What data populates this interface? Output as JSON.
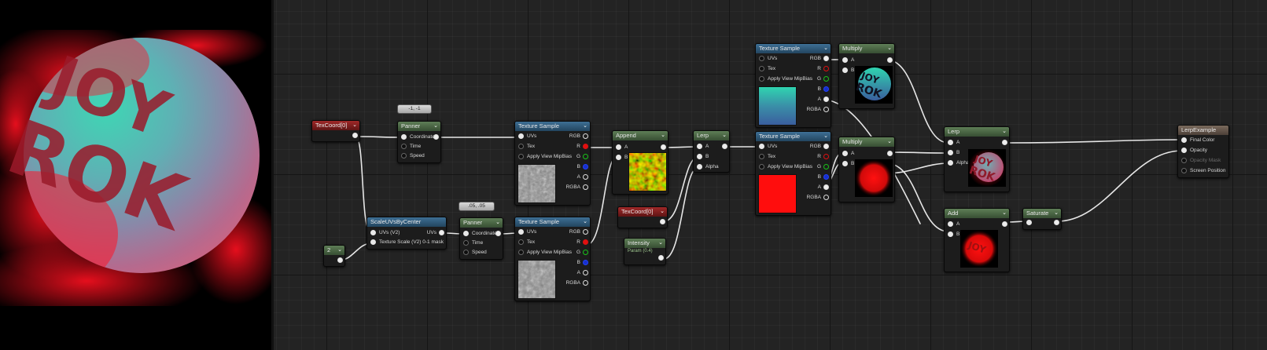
{
  "preview": {
    "logo_line1": "JOY",
    "logo_line2": "ROK"
  },
  "nodes": {
    "texcoord0": {
      "title": "TexCoord[0]"
    },
    "const2": {
      "title": "2"
    },
    "panner1": {
      "title": "Panner",
      "comment": "-1, -1",
      "pins": [
        "Coordinate",
        "Time",
        "Speed"
      ]
    },
    "scaleuvs": {
      "title": "ScaleUVsByCenter",
      "pin_uvs": "UVs (V2)",
      "pin_scale": "Texture Scale (V2) 0-1 mask",
      "out_uvs": "UVs"
    },
    "panner2": {
      "title": "Panner",
      "comment": ".05, .05",
      "pins": [
        "Coordinate",
        "Time",
        "Speed"
      ]
    },
    "texsample1": {
      "title": "Texture Sample",
      "inputs": [
        "UVs",
        "Tex",
        "Apply View MipBias"
      ],
      "outputs": [
        "RGB",
        "R",
        "G",
        "B",
        "A",
        "RGBA"
      ]
    },
    "texsample2": {
      "title": "Texture Sample",
      "inputs": [
        "UVs",
        "Tex",
        "Apply View MipBias"
      ],
      "outputs": [
        "RGB",
        "R",
        "G",
        "B",
        "A",
        "RGBA"
      ]
    },
    "append": {
      "title": "Append",
      "inputs": [
        "A",
        "B"
      ]
    },
    "texcoord0b": {
      "title": "TexCoord[0]"
    },
    "intensity": {
      "title": "Intensity",
      "subtitle": "Param (0.4)"
    },
    "lerp1": {
      "title": "Lerp",
      "inputs": [
        "A",
        "B",
        "Alpha"
      ]
    },
    "texsample3": {
      "title": "Texture Sample",
      "inputs": [
        "UVs",
        "Tex",
        "Apply View MipBias"
      ],
      "outputs": [
        "RGB",
        "R",
        "G",
        "B",
        "A",
        "RGBA"
      ]
    },
    "texsample4": {
      "title": "Texture Sample",
      "inputs": [
        "UVs",
        "Tex",
        "Apply View MipBias"
      ],
      "outputs": [
        "RGB",
        "R",
        "G",
        "B",
        "A",
        "RGBA"
      ]
    },
    "multiply1": {
      "title": "Multiply",
      "inputs": [
        "A",
        "B"
      ],
      "thumb_text1": "JOY",
      "thumb_text2": "ROK"
    },
    "multiply2": {
      "title": "Multiply",
      "inputs": [
        "A",
        "B"
      ]
    },
    "lerp2": {
      "title": "Lerp",
      "inputs": [
        "A",
        "B",
        "Alpha"
      ],
      "thumb_text1": "JOY",
      "thumb_text2": "ROK"
    },
    "add": {
      "title": "Add",
      "inputs": [
        "A",
        "B"
      ],
      "thumb_text": "JOY"
    },
    "saturate": {
      "title": "Saturate"
    },
    "result": {
      "title": "LerpExample",
      "inputs": [
        "Final Color",
        "Opacity",
        "Opacity Mask",
        "Screen Position"
      ]
    }
  },
  "colors": {
    "graph_bg": "#232323",
    "texture_header": "#3d6f95",
    "math_header": "#5e7e56",
    "texcoord_header": "#a02828",
    "result_header": "#7a6a5c",
    "red_pin": "#e01010",
    "green_pin": "#19c419",
    "blue_pin": "#2040ff"
  }
}
